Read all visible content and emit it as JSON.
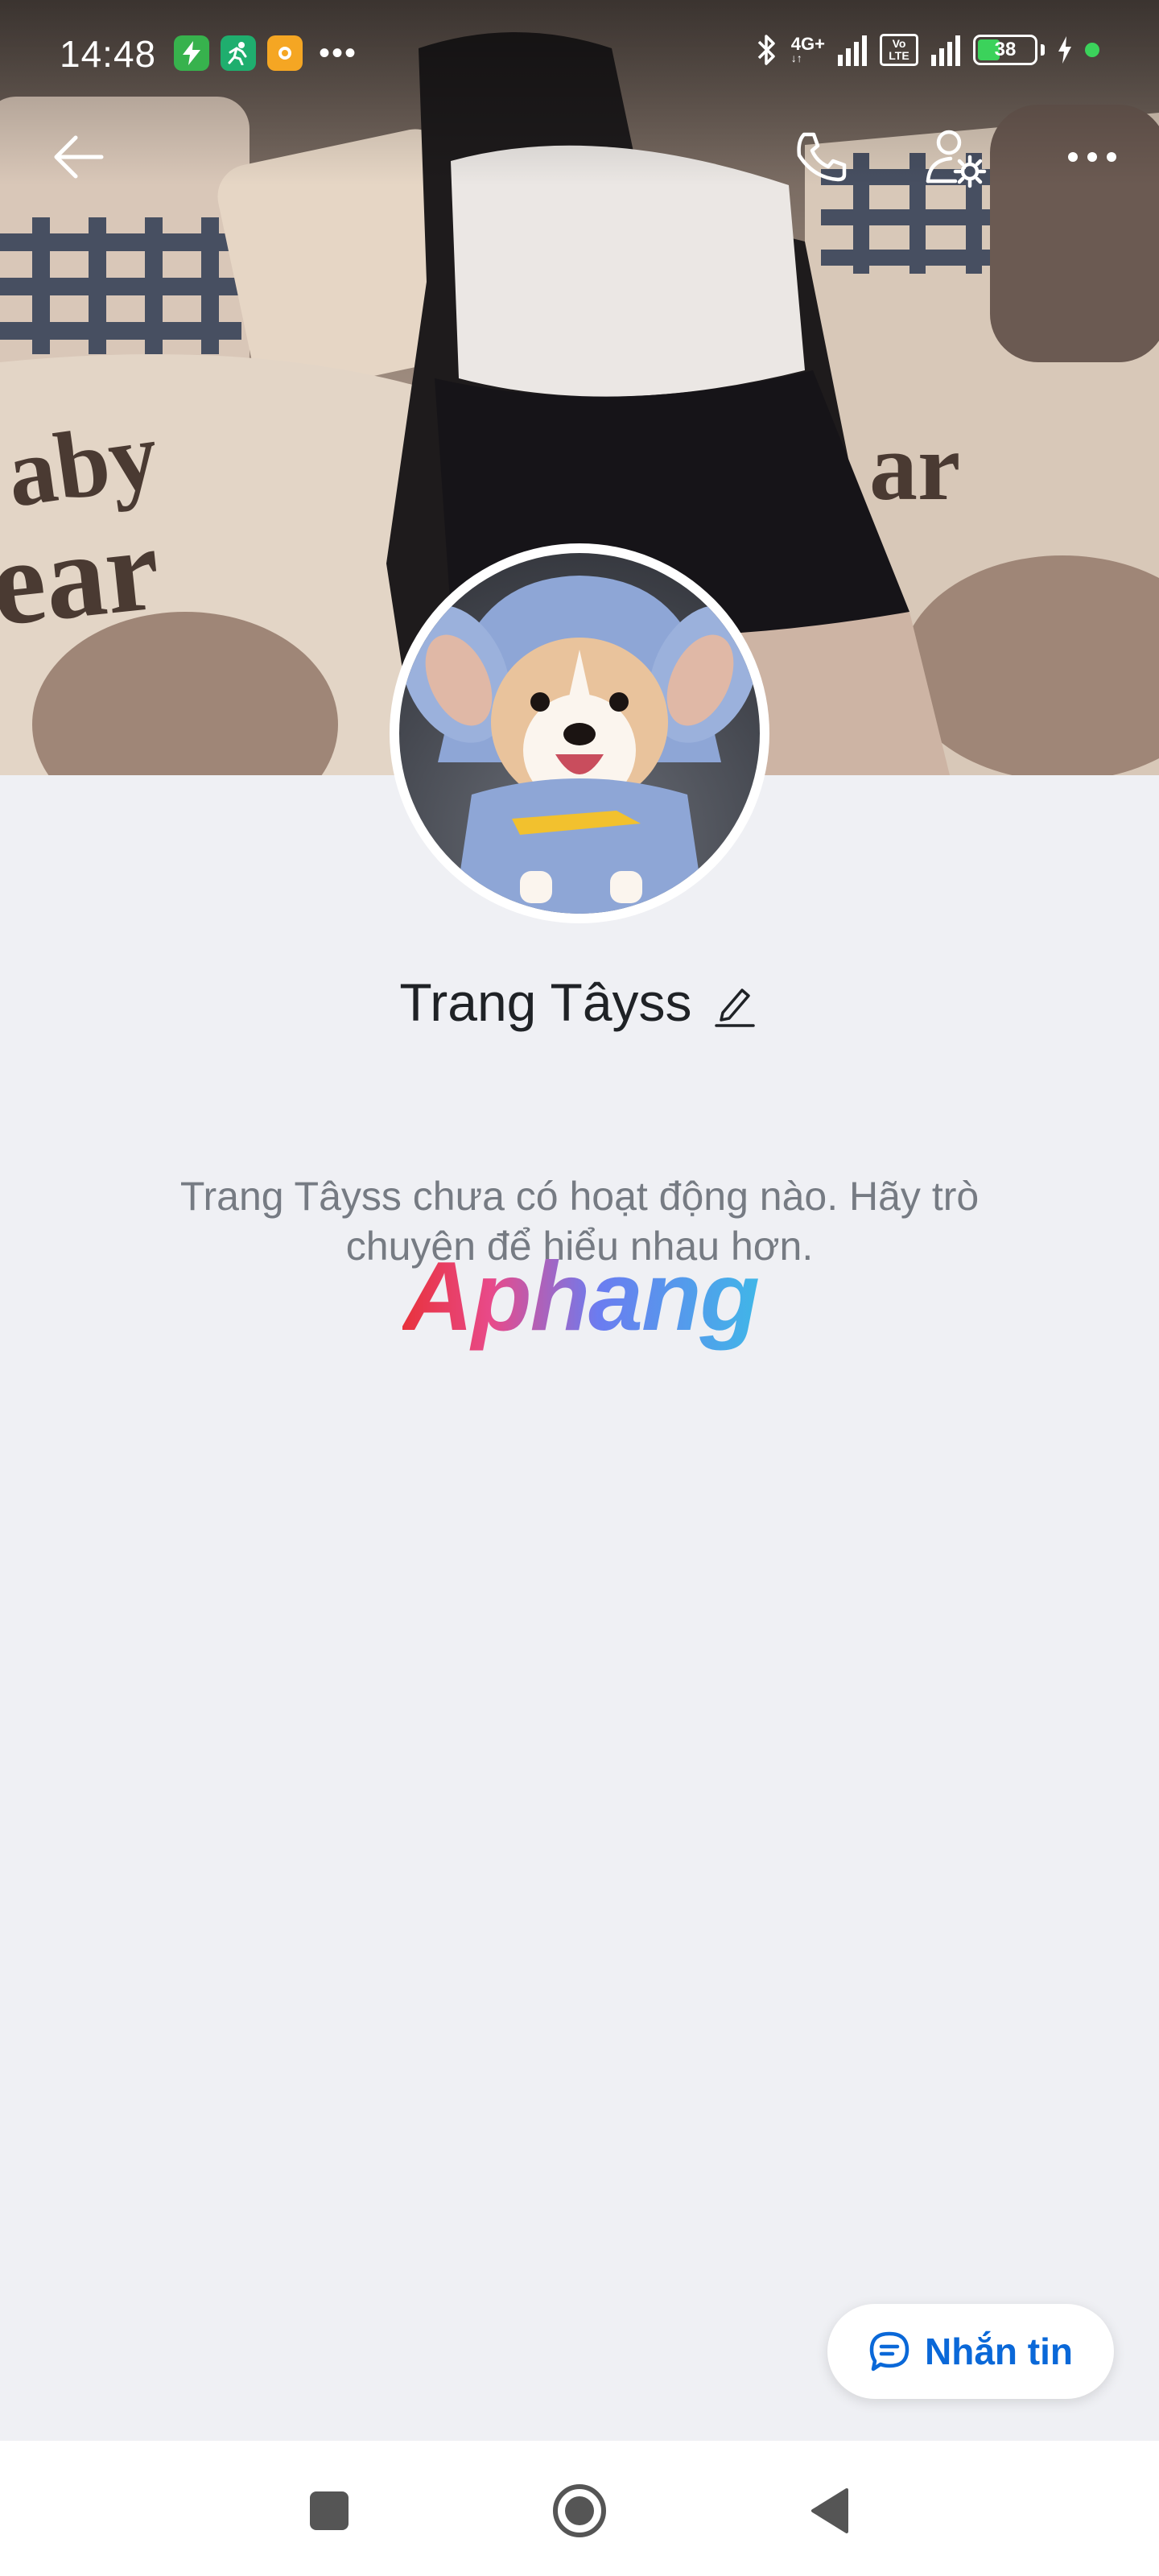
{
  "status_bar": {
    "time": "14:48",
    "network_label": "4G+",
    "volte_label": "Vo LTE",
    "battery_level": "38"
  },
  "profile": {
    "name": "Trang Tâyss",
    "empty_activity_text": "Trang Tâyss chưa có hoạt động nào. Hãy trò chuyện để hiểu nhau hơn."
  },
  "watermark": "Aphang",
  "actions": {
    "message_label": "Nhắn tin"
  },
  "colors": {
    "background": "#eff0f4",
    "accent": "#0a68d8",
    "battery_green": "#3bd25b"
  },
  "icons": {
    "back": "back-arrow-icon",
    "call": "phone-icon",
    "profile_settings": "user-settings-icon",
    "more": "more-dots-icon",
    "edit": "pencil-icon",
    "message": "chat-bubble-icon"
  }
}
